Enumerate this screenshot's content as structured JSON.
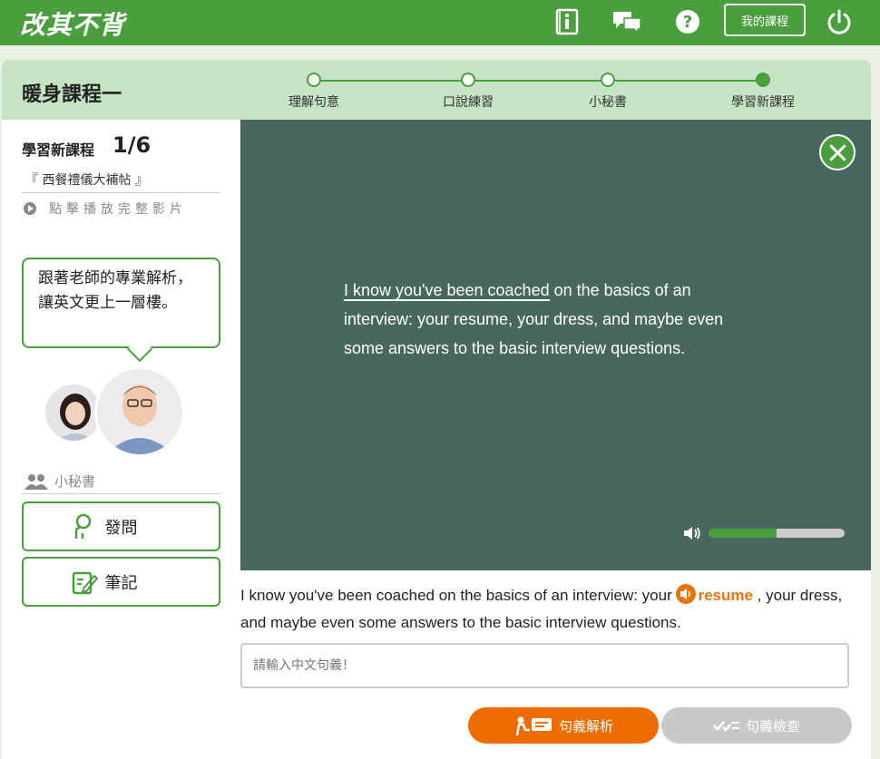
{
  "header": {
    "logo_text": "改其不背",
    "icons": [
      "info-book-icon",
      "chat-icon",
      "help-icon",
      "power-icon"
    ],
    "my_course_label": "我的課程",
    "brand_color": "#4a9e3e"
  },
  "course": {
    "title": "暖身課程一",
    "steps": [
      {
        "label": "理解句意",
        "state": "pending"
      },
      {
        "label": "口說練習",
        "state": "pending"
      },
      {
        "label": "小秘書",
        "state": "pending"
      },
      {
        "label": "學習新課程",
        "state": "current"
      }
    ]
  },
  "sidebar": {
    "lesson_header": "學習新課程",
    "lesson_number": "1/6",
    "lesson_name": "『 西餐禮儀大補帖 』",
    "play_full_label": "點擊播放完整影片",
    "tip_text": "跟著老師的專業解析，讓英文更上一層樓。",
    "secretary_label": "小秘書",
    "ask_button": "發問",
    "note_button": "筆記"
  },
  "video": {
    "caption_highlight": "I know you've been coached",
    "caption_rest": " on the basics of an interview: your resume, your dress, and maybe even some answers to the basic interview questions.",
    "volume_level": 0.5
  },
  "sentence": {
    "before": "I know you've been coached on the basics of an interview: your ",
    "vocab": "resume",
    "after": " , your dress, and maybe even some answers to the basic interview questions."
  },
  "translation": {
    "placeholder": "請輸入中文句義！",
    "value": ""
  },
  "actions": {
    "analysis_label": "句義解析",
    "check_label": "句義檢查",
    "analysis_color": "#ec6c00",
    "check_color": "#c8c8c8"
  }
}
